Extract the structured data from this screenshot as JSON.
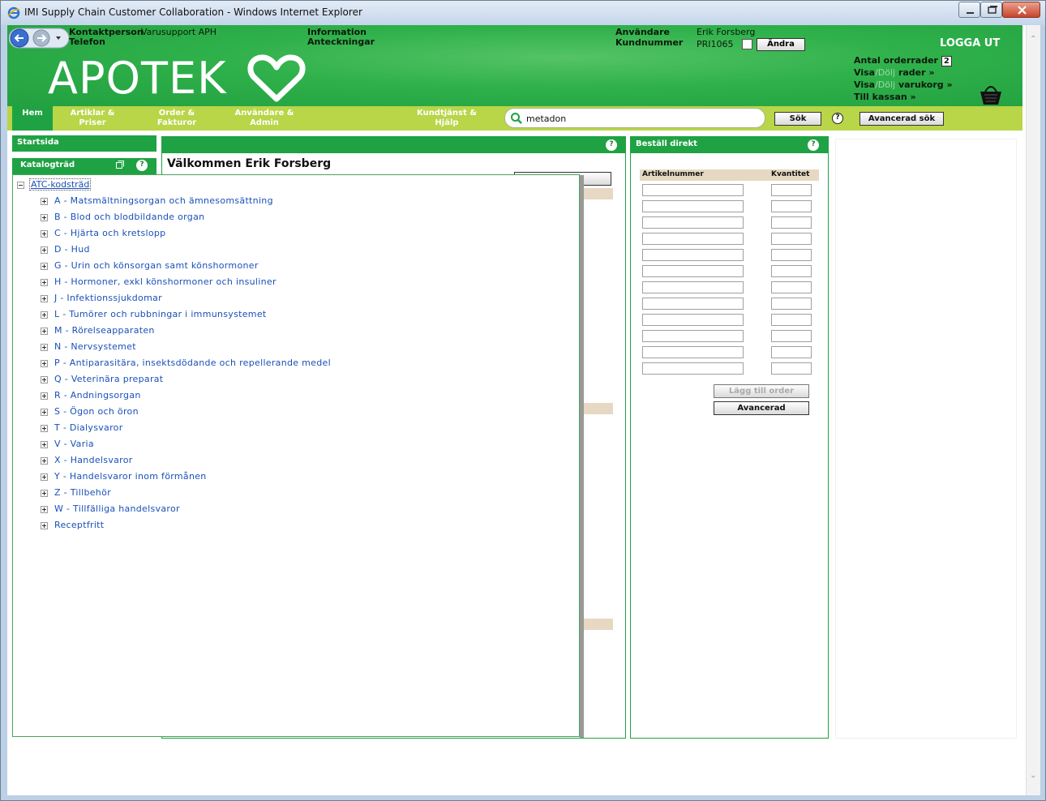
{
  "window": {
    "title": "IMI Supply Chain Customer Collaboration - Windows Internet Explorer"
  },
  "header": {
    "contact_label": "Kontaktperson",
    "contact_value": "Varusupport APH",
    "phone_label": "Telefon",
    "info_label": "Information",
    "notes_label": "Anteckningar",
    "user_label": "Användare",
    "user_value": "Erik Forsberg",
    "customer_label": "Kundnummer",
    "customer_value": "PRI1065",
    "change_button": "Ändra",
    "logo": "APOTEK",
    "logout": "LOGGA UT",
    "order_rows_label": "Antal orderrader",
    "order_rows_count": "2",
    "show_rows_a": "Visa",
    "show_rows_b": "Dölj",
    "show_rows_c": "rader »",
    "show_cart_a": "Visa",
    "show_cart_b": "Dölj",
    "show_cart_c": "varukorg »",
    "checkout": "Till kassan »"
  },
  "nav": {
    "items": [
      {
        "label": "Hem"
      },
      {
        "label": "Artiklar & Priser"
      },
      {
        "label": "Order & Fakturor"
      },
      {
        "label": "Användare & Admin"
      },
      {
        "label": "Kundtjänst & Hjälp"
      }
    ],
    "search_value": "metadon",
    "search_button": "Sök",
    "help": "?",
    "advanced_search": "Avancerad sök"
  },
  "sidebar": {
    "start": "Startsida",
    "catalog_title": "Katalogträd",
    "tree_root": "ATC-kodsträd",
    "tree_items": [
      "A - Matsmältningsorgan och ämnesomsättning",
      "B - Blod och blodbildande organ",
      "C - Hjärta och kretslopp",
      "D - Hud",
      "G - Urin och könsorgan samt könshormoner",
      "H - Hormoner, exkl könshormoner och insuliner",
      "J - Infektionssjukdomar",
      "L - Tumörer och rubbningar i immunsystemet",
      "M - Rörelseapparaten",
      "N - Nervsystemet",
      "P - Antiparasitära, insektsdödande och repellerande medel",
      "Q - Veterinära preparat",
      "R - Andningsorgan",
      "S - Ögon och öron",
      "T - Dialysvaror",
      "V - Varia",
      "X - Handelsvaror",
      "Y - Handelsvaror inom förmånen",
      "Z - Tillbehör",
      "W - Tillfälliga handelsvaror",
      "Receptfritt"
    ]
  },
  "center": {
    "welcome": "Välkommen Erik Forsberg"
  },
  "order_direct": {
    "title": "Beställ direkt",
    "col_article": "Artikelnummer",
    "col_qty": "Kvantitet",
    "add_button": "Lägg till order",
    "advanced_button": "Avancerad"
  },
  "colors": {
    "brand_green": "#1fa243",
    "nav_lime": "#b9d548",
    "link_blue": "#1a50b8"
  }
}
